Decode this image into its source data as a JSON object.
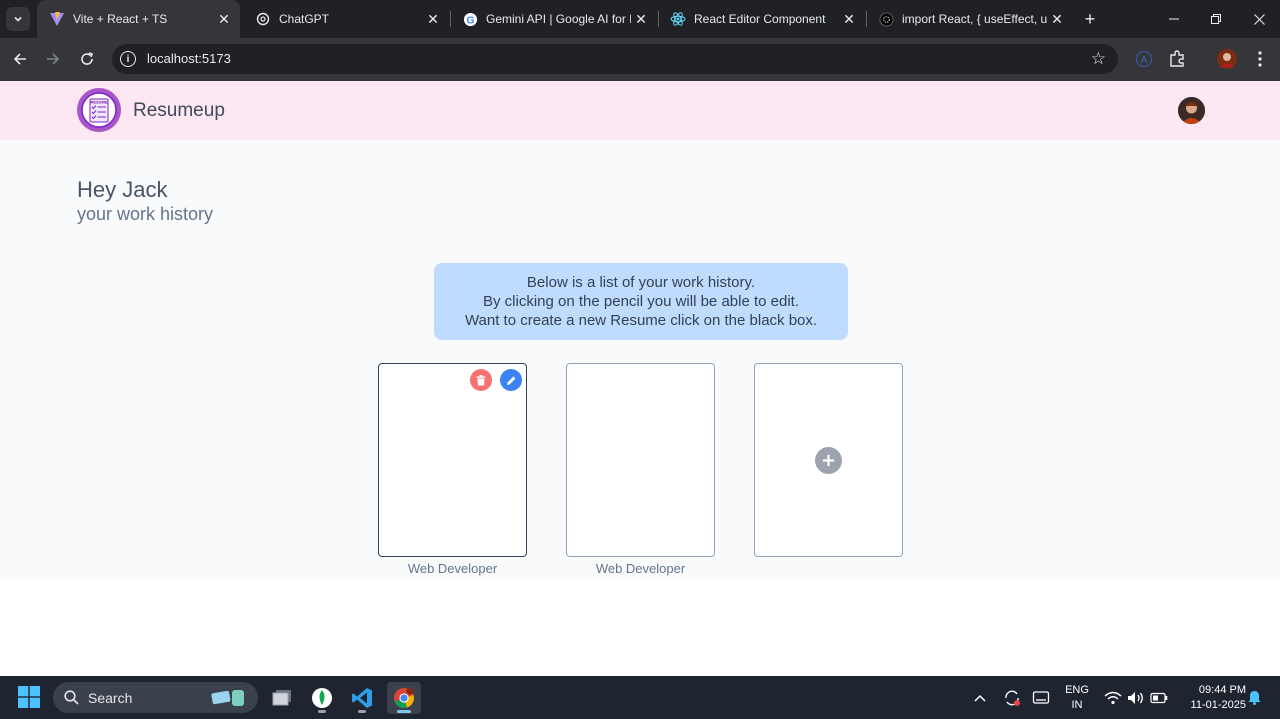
{
  "browser": {
    "tabs": [
      {
        "title": "Vite + React + TS",
        "icon": "vite-icon"
      },
      {
        "title": "ChatGPT",
        "icon": "chatgpt-icon"
      },
      {
        "title": "Gemini API  |  Google AI for I",
        "icon": "google-icon"
      },
      {
        "title": "React Editor Component",
        "icon": "react-icon"
      },
      {
        "title": "import React, { useEffect, use",
        "icon": "openai-icon"
      }
    ],
    "url": "localhost:5173"
  },
  "app": {
    "brand": "Resumeup",
    "logo_text": "RESUME",
    "greeting": "Hey Jack",
    "subtitle": "your work history",
    "info_lines": [
      "Below is a list of your work history.",
      "By clicking on the pencil you will be able to edit.",
      "Want to create a new Resume click on the black box."
    ],
    "cards": [
      {
        "label": "Web Developer"
      },
      {
        "label": "Web Developer"
      }
    ],
    "colors": {
      "header_bg": "#fce7f3",
      "info_bg": "#bfdbfe",
      "delete": "#f87171",
      "edit": "#3b82f6",
      "add": "#9ca3af"
    }
  },
  "taskbar": {
    "search_label": "Search",
    "lang_top": "ENG",
    "lang_bottom": "IN",
    "time": "09:44 PM",
    "date": "11-01-2025"
  }
}
